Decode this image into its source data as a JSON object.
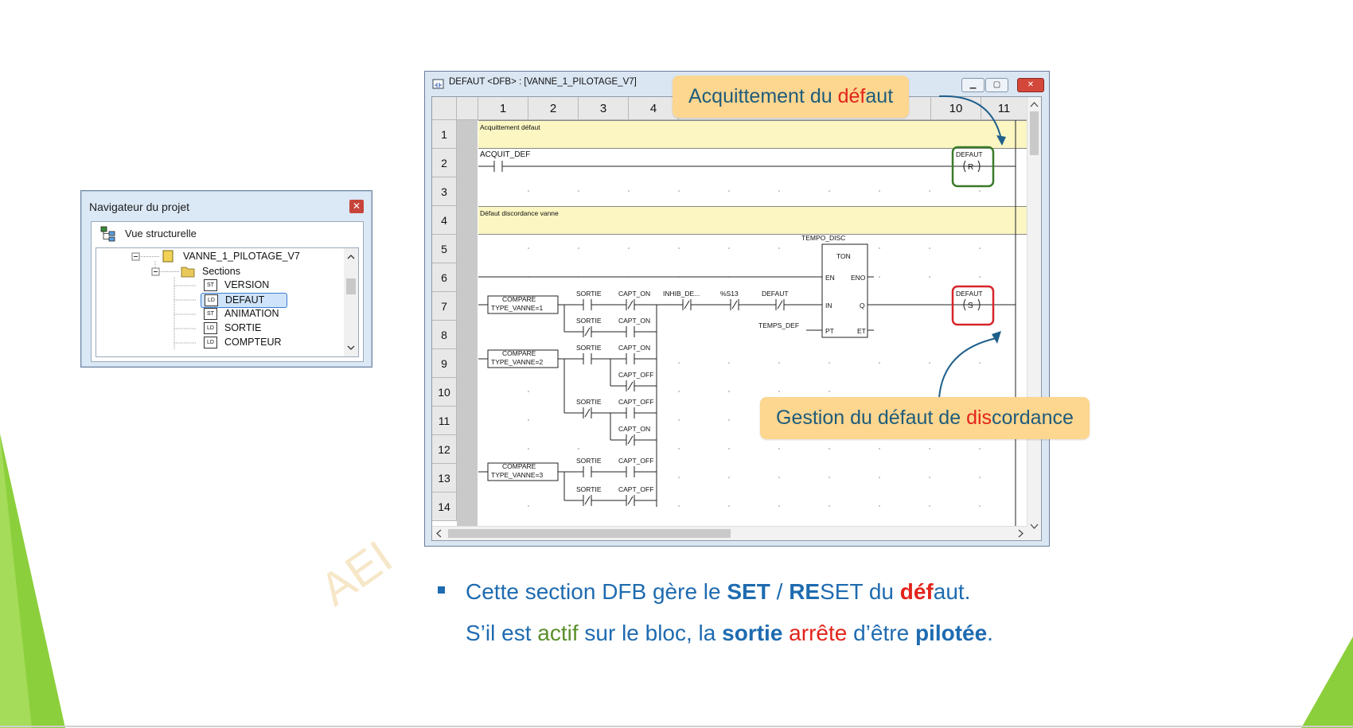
{
  "navigator": {
    "title": "Navigateur du projet",
    "close_icon": "✕",
    "view_label": "Vue structurelle",
    "tree": [
      {
        "label": "VANNE_1_PILOTAGE_V7",
        "icon": ""
      },
      {
        "label": "Sections",
        "icon": ""
      },
      {
        "label": "VERSION",
        "icon": "ST"
      },
      {
        "label": "DEFAUT",
        "icon": "LD",
        "selected": true
      },
      {
        "label": "ANIMATION",
        "icon": "ST"
      },
      {
        "label": "SORTIE",
        "icon": "LD"
      },
      {
        "label": "COMPTEUR",
        "icon": "LD"
      }
    ]
  },
  "dfb_window": {
    "title": "DEFAUT <DFB> : [VANNE_1_PILOTAGE_V7]",
    "columns": [
      "1",
      "2",
      "3",
      "4",
      "10",
      "11"
    ],
    "rows": [
      "1",
      "2",
      "3",
      "4",
      "5",
      "6",
      "7",
      "8",
      "9",
      "10",
      "11",
      "12",
      "13",
      "14"
    ],
    "comments": [
      "Acquittement défaut",
      "Défaut discordance vanne"
    ],
    "ladder": {
      "acquit_contact": "ACQUIT_DEF",
      "reset_coil": "DEFAUT",
      "reset_symbol": "R",
      "set_coil": "DEFAUT",
      "set_symbol": "S",
      "timer_instance": "TEMPO_DISC",
      "timer_type": "TON",
      "timer_pins": {
        "en": "EN",
        "eno": "ENO",
        "in": "IN",
        "q": "Q",
        "pt": "PT",
        "et": "ET"
      },
      "pt_input": "TEMPS_DEF",
      "compare1": [
        "COMPARE",
        "TYPE_VANNE=1"
      ],
      "compare2": [
        "COMPARE",
        "TYPE_VANNE=2"
      ],
      "compare3": [
        "COMPARE",
        "TYPE_VANNE=3"
      ],
      "contacts": {
        "sortie": "SORTIE",
        "capt_on": "CAPT_ON",
        "capt_off": "CAPT_OFF",
        "inhib": "INHIB_DE...",
        "s13": "%S13",
        "defaut": "DEFAUT"
      }
    }
  },
  "callouts": {
    "top": {
      "part1": "Acquittement du ",
      "part2": "déf",
      "part3": "aut"
    },
    "bottom": {
      "part1": "Gestion du défaut de ",
      "part2": "dis",
      "part3": "cordance"
    }
  },
  "bullets": {
    "line1": {
      "a": "Cette section DFB gère le ",
      "b": "SET",
      "c": " / ",
      "d": "RE",
      "e": "SET du ",
      "f": "déf",
      "g": "aut."
    },
    "line2": {
      "a": "S’il est ",
      "b": "actif",
      "c": " sur le bloc, la ",
      "d": "sortie",
      "e": " ",
      "f": "arrête",
      "g": " d’être ",
      "h": "pilotée",
      "i": "."
    }
  },
  "watermark": "AEI",
  "colors": {
    "callout": "#fdd690",
    "accent_blue": "#1e6bb0",
    "red": "#e2241b",
    "green": "#5a8f2d",
    "slide_green": "#8ccf3c"
  }
}
